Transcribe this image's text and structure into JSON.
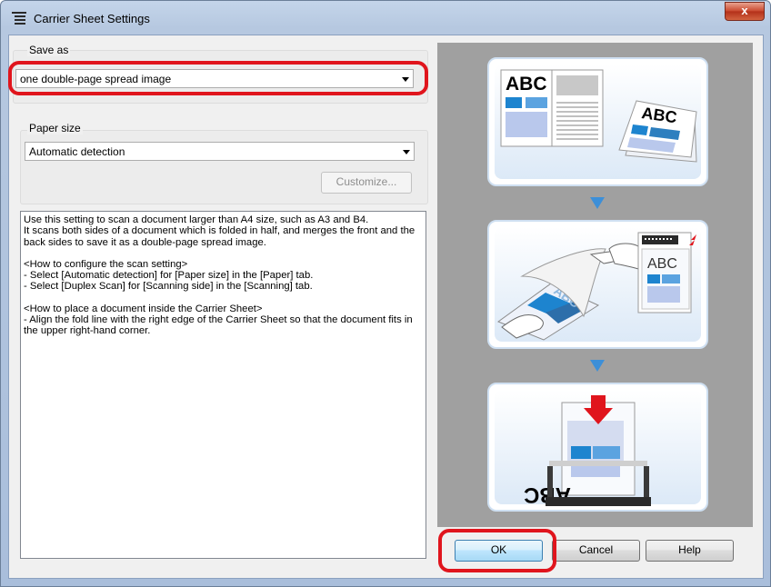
{
  "window": {
    "title": "Carrier Sheet Settings",
    "close_label": "x"
  },
  "save_as": {
    "group_label": "Save as",
    "selected": "one double-page spread image"
  },
  "paper_size": {
    "group_label": "Paper size",
    "selected": "Automatic detection",
    "customize_label": "Customize..."
  },
  "description": {
    "paragraphs": [
      "Use this setting to scan a document larger than A4 size, such as A3 and B4.\nIt scans both sides of a document which is folded in half, and merges the front and the back sides to save it as a double-page spread image.",
      "<How to configure the scan setting>\n- Select [Automatic detection] for [Paper size] in the [Paper] tab.\n- Select [Duplex Scan] for [Scanning side] in the [Scanning] tab.",
      "<How to place a document inside the Carrier Sheet>\n- Align the fold line with the right edge of the Carrier Sheet so that the document fits in the upper right-hand corner."
    ]
  },
  "illustration": {
    "step1_text": "ABC",
    "step2_text": "ABC",
    "step3_text": "ABC"
  },
  "buttons": {
    "ok": "OK",
    "cancel": "Cancel",
    "help": "Help"
  },
  "colors": {
    "highlight": "#e0151d",
    "accent_blue": "#3d8fd8",
    "window_frame": "#b6c8e0"
  }
}
